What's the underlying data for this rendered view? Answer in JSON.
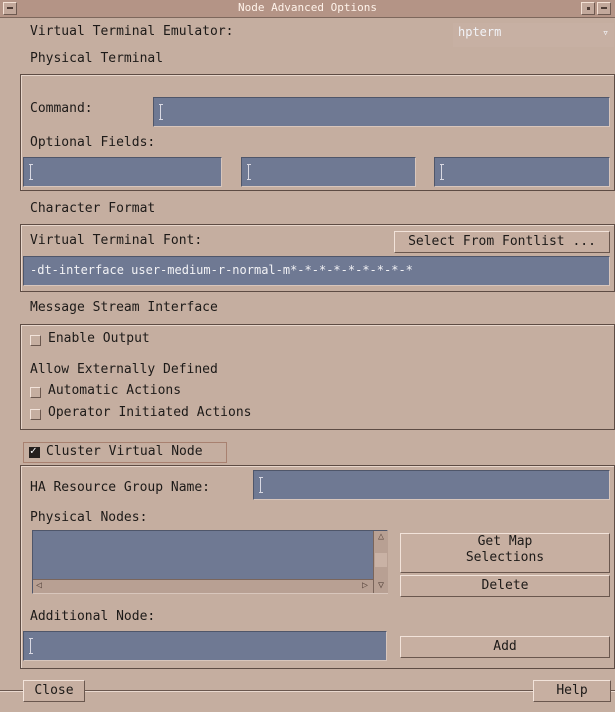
{
  "window": {
    "title": "Node Advanced Options"
  },
  "vte": {
    "label": "Virtual Terminal Emulator:",
    "value": "hpterm"
  },
  "physical": {
    "heading": "Physical Terminal",
    "command_label": "Command:",
    "command_value": "",
    "optional_label": "Optional Fields:"
  },
  "charfmt": {
    "heading": "Character Format",
    "font_label": "Virtual Terminal Font:",
    "select_button": "Select From Fontlist ...",
    "font_value": "-dt-interface user-medium-r-normal-m*-*-*-*-*-*-*-*-*"
  },
  "msi": {
    "heading": "Message Stream Interface",
    "enable_output": "Enable Output",
    "allow_label": "Allow Externally Defined",
    "automatic": "Automatic Actions",
    "operator": "Operator Initiated Actions"
  },
  "cluster": {
    "checkbox_label": "Cluster Virtual Node",
    "ha_label": "HA Resource Group Name:",
    "ha_value": "",
    "nodes_label": "Physical Nodes:",
    "get_map": "Get Map\nSelections",
    "delete": "Delete",
    "additional_label": "Additional Node:",
    "add": "Add"
  },
  "footer": {
    "close": "Close",
    "help": "Help"
  },
  "colors": {
    "field_bg": "#6f7993",
    "dialog_bg": "#c5aea0",
    "title_bg": "#b49486"
  }
}
